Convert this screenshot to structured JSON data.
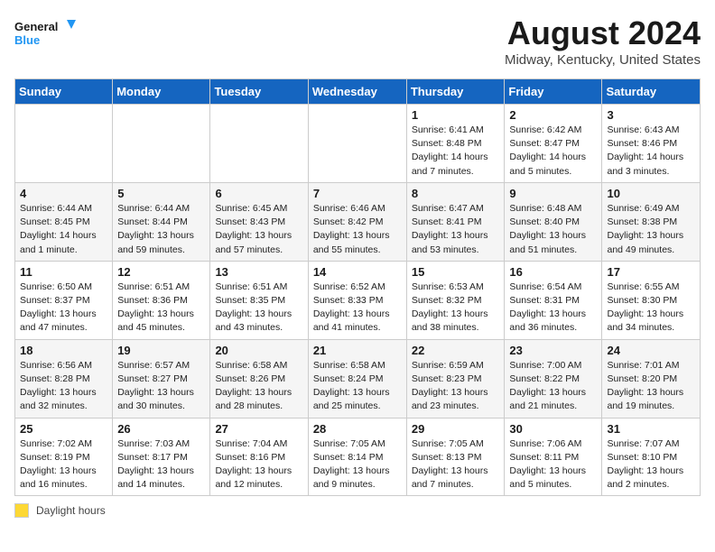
{
  "header": {
    "logo_line1": "General",
    "logo_line2": "Blue",
    "month_year": "August 2024",
    "location": "Midway, Kentucky, United States"
  },
  "days_of_week": [
    "Sunday",
    "Monday",
    "Tuesday",
    "Wednesday",
    "Thursday",
    "Friday",
    "Saturday"
  ],
  "legend": {
    "box_label": "Daylight hours"
  },
  "weeks": [
    [
      {
        "day": "",
        "detail": ""
      },
      {
        "day": "",
        "detail": ""
      },
      {
        "day": "",
        "detail": ""
      },
      {
        "day": "",
        "detail": ""
      },
      {
        "day": "1",
        "detail": "Sunrise: 6:41 AM\nSunset: 8:48 PM\nDaylight: 14 hours\nand 7 minutes."
      },
      {
        "day": "2",
        "detail": "Sunrise: 6:42 AM\nSunset: 8:47 PM\nDaylight: 14 hours\nand 5 minutes."
      },
      {
        "day": "3",
        "detail": "Sunrise: 6:43 AM\nSunset: 8:46 PM\nDaylight: 14 hours\nand 3 minutes."
      }
    ],
    [
      {
        "day": "4",
        "detail": "Sunrise: 6:44 AM\nSunset: 8:45 PM\nDaylight: 14 hours\nand 1 minute."
      },
      {
        "day": "5",
        "detail": "Sunrise: 6:44 AM\nSunset: 8:44 PM\nDaylight: 13 hours\nand 59 minutes."
      },
      {
        "day": "6",
        "detail": "Sunrise: 6:45 AM\nSunset: 8:43 PM\nDaylight: 13 hours\nand 57 minutes."
      },
      {
        "day": "7",
        "detail": "Sunrise: 6:46 AM\nSunset: 8:42 PM\nDaylight: 13 hours\nand 55 minutes."
      },
      {
        "day": "8",
        "detail": "Sunrise: 6:47 AM\nSunset: 8:41 PM\nDaylight: 13 hours\nand 53 minutes."
      },
      {
        "day": "9",
        "detail": "Sunrise: 6:48 AM\nSunset: 8:40 PM\nDaylight: 13 hours\nand 51 minutes."
      },
      {
        "day": "10",
        "detail": "Sunrise: 6:49 AM\nSunset: 8:38 PM\nDaylight: 13 hours\nand 49 minutes."
      }
    ],
    [
      {
        "day": "11",
        "detail": "Sunrise: 6:50 AM\nSunset: 8:37 PM\nDaylight: 13 hours\nand 47 minutes."
      },
      {
        "day": "12",
        "detail": "Sunrise: 6:51 AM\nSunset: 8:36 PM\nDaylight: 13 hours\nand 45 minutes."
      },
      {
        "day": "13",
        "detail": "Sunrise: 6:51 AM\nSunset: 8:35 PM\nDaylight: 13 hours\nand 43 minutes."
      },
      {
        "day": "14",
        "detail": "Sunrise: 6:52 AM\nSunset: 8:33 PM\nDaylight: 13 hours\nand 41 minutes."
      },
      {
        "day": "15",
        "detail": "Sunrise: 6:53 AM\nSunset: 8:32 PM\nDaylight: 13 hours\nand 38 minutes."
      },
      {
        "day": "16",
        "detail": "Sunrise: 6:54 AM\nSunset: 8:31 PM\nDaylight: 13 hours\nand 36 minutes."
      },
      {
        "day": "17",
        "detail": "Sunrise: 6:55 AM\nSunset: 8:30 PM\nDaylight: 13 hours\nand 34 minutes."
      }
    ],
    [
      {
        "day": "18",
        "detail": "Sunrise: 6:56 AM\nSunset: 8:28 PM\nDaylight: 13 hours\nand 32 minutes."
      },
      {
        "day": "19",
        "detail": "Sunrise: 6:57 AM\nSunset: 8:27 PM\nDaylight: 13 hours\nand 30 minutes."
      },
      {
        "day": "20",
        "detail": "Sunrise: 6:58 AM\nSunset: 8:26 PM\nDaylight: 13 hours\nand 28 minutes."
      },
      {
        "day": "21",
        "detail": "Sunrise: 6:58 AM\nSunset: 8:24 PM\nDaylight: 13 hours\nand 25 minutes."
      },
      {
        "day": "22",
        "detail": "Sunrise: 6:59 AM\nSunset: 8:23 PM\nDaylight: 13 hours\nand 23 minutes."
      },
      {
        "day": "23",
        "detail": "Sunrise: 7:00 AM\nSunset: 8:22 PM\nDaylight: 13 hours\nand 21 minutes."
      },
      {
        "day": "24",
        "detail": "Sunrise: 7:01 AM\nSunset: 8:20 PM\nDaylight: 13 hours\nand 19 minutes."
      }
    ],
    [
      {
        "day": "25",
        "detail": "Sunrise: 7:02 AM\nSunset: 8:19 PM\nDaylight: 13 hours\nand 16 minutes."
      },
      {
        "day": "26",
        "detail": "Sunrise: 7:03 AM\nSunset: 8:17 PM\nDaylight: 13 hours\nand 14 minutes."
      },
      {
        "day": "27",
        "detail": "Sunrise: 7:04 AM\nSunset: 8:16 PM\nDaylight: 13 hours\nand 12 minutes."
      },
      {
        "day": "28",
        "detail": "Sunrise: 7:05 AM\nSunset: 8:14 PM\nDaylight: 13 hours\nand 9 minutes."
      },
      {
        "day": "29",
        "detail": "Sunrise: 7:05 AM\nSunset: 8:13 PM\nDaylight: 13 hours\nand 7 minutes."
      },
      {
        "day": "30",
        "detail": "Sunrise: 7:06 AM\nSunset: 8:11 PM\nDaylight: 13 hours\nand 5 minutes."
      },
      {
        "day": "31",
        "detail": "Sunrise: 7:07 AM\nSunset: 8:10 PM\nDaylight: 13 hours\nand 2 minutes."
      }
    ]
  ]
}
